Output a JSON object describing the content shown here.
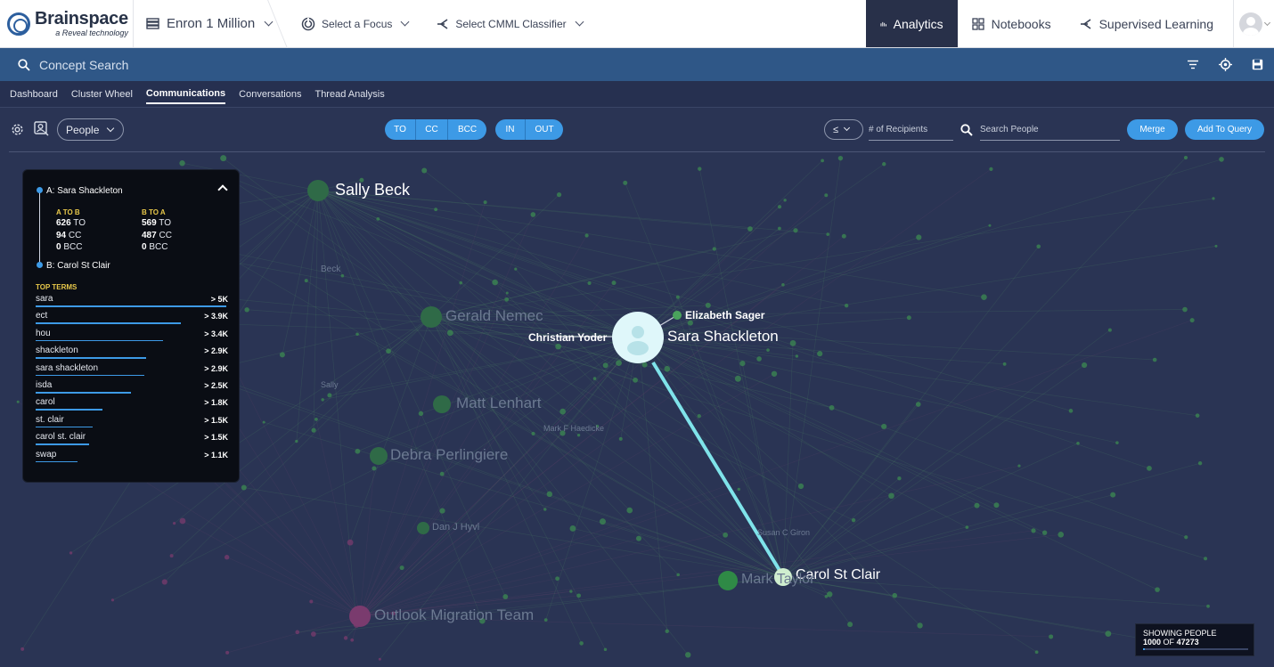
{
  "brand": {
    "name": "Brainspace",
    "sub": "a Reveal technology"
  },
  "topbar": {
    "project": "Enron 1 Million",
    "focus": "Select a Focus",
    "classifier": "Select CMML Classifier",
    "nav": {
      "analytics": "Analytics",
      "notebooks": "Notebooks",
      "supervised": "Supervised Learning"
    }
  },
  "search": {
    "placeholder": "Concept Search"
  },
  "tabs": [
    "Dashboard",
    "Cluster Wheel",
    "Communications",
    "Conversations",
    "Thread Analysis"
  ],
  "active_tab": "Communications",
  "toolbar": {
    "people": "People",
    "fields": [
      "TO",
      "CC",
      "BCC"
    ],
    "directions": [
      "IN",
      "OUT"
    ],
    "comparator": "≤",
    "recipients_placeholder": "# of Recipients",
    "search_people_placeholder": "Search People",
    "merge": "Merge",
    "add_to_query": "Add To Query"
  },
  "panel": {
    "a_label": "A: Sara Shackleton",
    "b_label": "B: Carol St Clair",
    "a_to_b_head": "A TO B",
    "b_to_a_head": "B TO A",
    "a_to_b": {
      "to": "626",
      "cc": "94",
      "bcc": "0"
    },
    "b_to_a": {
      "to": "569",
      "cc": "487",
      "bcc": "0"
    },
    "units": {
      "to": "TO",
      "cc": "CC",
      "bcc": "BCC"
    },
    "top_terms_head": "TOP TERMS",
    "terms": [
      {
        "name": "sara",
        "value": "> 5K",
        "frac": 1.0
      },
      {
        "name": "ect",
        "value": "> 3.9K",
        "frac": 0.76
      },
      {
        "name": "hou",
        "value": "> 3.4K",
        "frac": 0.67
      },
      {
        "name": "shackleton",
        "value": "> 2.9K",
        "frac": 0.58
      },
      {
        "name": "sara shackleton",
        "value": "> 2.9K",
        "frac": 0.57
      },
      {
        "name": "isda",
        "value": "> 2.5K",
        "frac": 0.5
      },
      {
        "name": "carol",
        "value": "> 1.8K",
        "frac": 0.35
      },
      {
        "name": "st. clair",
        "value": "> 1.5K",
        "frac": 0.3
      },
      {
        "name": "carol st. clair",
        "value": "> 1.5K",
        "frac": 0.28
      },
      {
        "name": "swap",
        "value": "> 1.1K",
        "frac": 0.22
      }
    ]
  },
  "graph": {
    "nodes": {
      "sara_shackleton": "Sara Shackleton",
      "carol_st_clair": "Carol St Clair",
      "elizabeth_sager": "Elizabeth Sager",
      "christian_yoder": "Christian Yoder",
      "sally_beck": "Sally Beck",
      "gerald_nemec": "Gerald Nemec",
      "matt_lenhart": "Matt Lenhart",
      "debra_perlingiere": "Debra Perlingiere",
      "dan_j_hyvl": "Dan J Hyvl",
      "outlook_migration": "Outlook Migration Team",
      "mark_hardiike": "Mark F Haedicke",
      "mark_taylor": "Mark Taylor",
      "beck": "Beck",
      "sally": "Sally",
      "susan_c_giron": "Susan C Giron"
    },
    "colors": {
      "focus": "#7fe3ea",
      "node": "#4aa35c",
      "edge": "#5ba86a"
    }
  },
  "showing": {
    "label": "SHOWING PEOPLE",
    "shown": "1000",
    "of": "OF",
    "total": "47273",
    "fraction": 0.021
  }
}
